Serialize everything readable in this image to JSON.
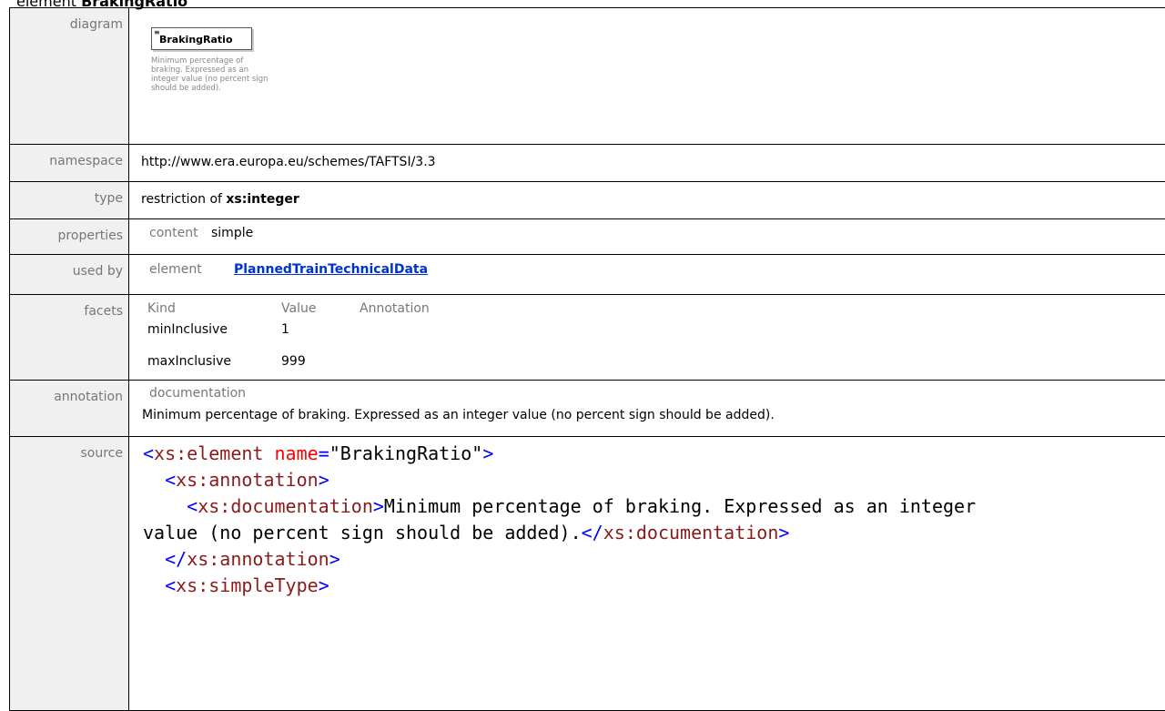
{
  "heading": {
    "prefix": "element",
    "name": "BrakingRatio"
  },
  "rows": {
    "diagram": {
      "label": "diagram",
      "box_name": "BrakingRatio",
      "desc": [
        "Minimum percentage of",
        "braking. Expressed as an",
        "integer value (no percent sign",
        "should be added)."
      ]
    },
    "namespace": {
      "label": "namespace",
      "value": "http://www.era.europa.eu/schemes/TAFTSI/3.3"
    },
    "type": {
      "label": "type",
      "prefix": "restriction of",
      "base": "xs:integer"
    },
    "properties": {
      "label": "properties",
      "key": "content",
      "value": "simple"
    },
    "used_by": {
      "label": "used by",
      "key": "element",
      "value": "PlannedTrainTechnicalData"
    },
    "facets": {
      "label": "facets",
      "headers": [
        "Kind",
        "Value",
        "Annotation"
      ],
      "items": [
        {
          "kind": "minInclusive",
          "value": "1",
          "annotation": ""
        },
        {
          "kind": "maxInclusive",
          "value": "999",
          "annotation": ""
        }
      ]
    },
    "annotation": {
      "label": "annotation",
      "key": "documentation",
      "text": "Minimum percentage of braking. Expressed as an integer value (no percent sign should be added)."
    },
    "source": {
      "label": "source",
      "lines": [
        {
          "indent": "",
          "open": "<",
          "tag": "xs:element",
          "attr": " name",
          "eq": "=",
          "str": "\"BrakingRatio\"",
          "close": ">",
          "text": "",
          "tail": ""
        },
        {
          "indent": "  ",
          "open": "<",
          "tag": "xs:annotation",
          "attr": "",
          "eq": "",
          "str": "",
          "close": ">",
          "text": "",
          "tail": ""
        },
        {
          "indent": "    ",
          "open": "<",
          "tag": "xs:documentation",
          "attr": "",
          "eq": "",
          "str": "",
          "close": ">",
          "text": "Minimum percentage of braking. Expressed as an integer",
          "tail": ""
        },
        {
          "indent": "",
          "open": "",
          "tag": "",
          "attr": "",
          "eq": "",
          "str": "",
          "close": "",
          "text": "value (no percent sign should be added).",
          "tail": "</xs:documentation>"
        },
        {
          "indent": "  ",
          "open": "</",
          "tag": "xs:annotation",
          "attr": "",
          "eq": "",
          "str": "",
          "close": ">",
          "text": "",
          "tail": ""
        },
        {
          "indent": "  ",
          "open": "<",
          "tag": "xs:simpleType",
          "attr": "",
          "eq": "",
          "str": "",
          "close": ">",
          "text": "",
          "tail": ""
        }
      ]
    }
  }
}
